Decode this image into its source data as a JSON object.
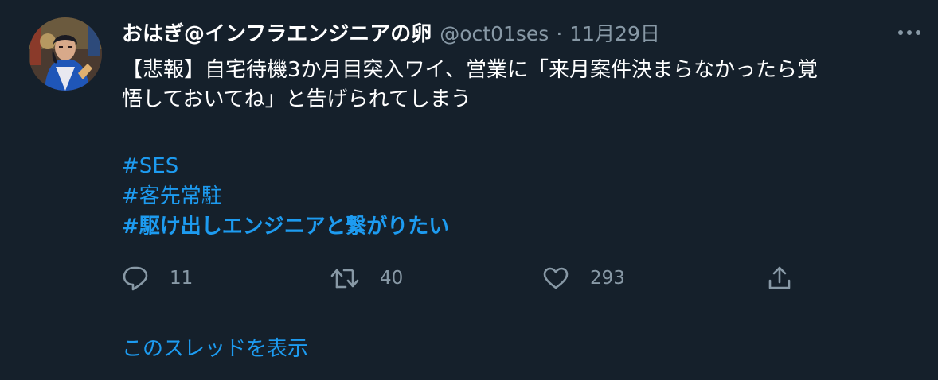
{
  "tweet": {
    "author": {
      "display_name": "おはぎ@インフラエンジニアの卵",
      "handle": "@oct01ses",
      "avatar_icon": "avatar-illustration"
    },
    "separator": "·",
    "timestamp": "11月29日",
    "text_line1": "【悲報】自宅待機3か月目突入ワイ、営業に「来月案件決まらなかったら覚",
    "text_line2": "悟しておいてね」と告げられてしまう",
    "hashtags": [
      "#SES",
      "#客先常駐",
      "#駆け出しエンジニアと繋がりたい"
    ],
    "actions": {
      "reply_count": "11",
      "retweet_count": "40",
      "like_count": "293"
    },
    "show_thread_label": "このスレッドを表示"
  },
  "colors": {
    "background": "#15202b",
    "text": "#ffffff",
    "secondary": "#8899a6",
    "link": "#1d9bf0"
  }
}
